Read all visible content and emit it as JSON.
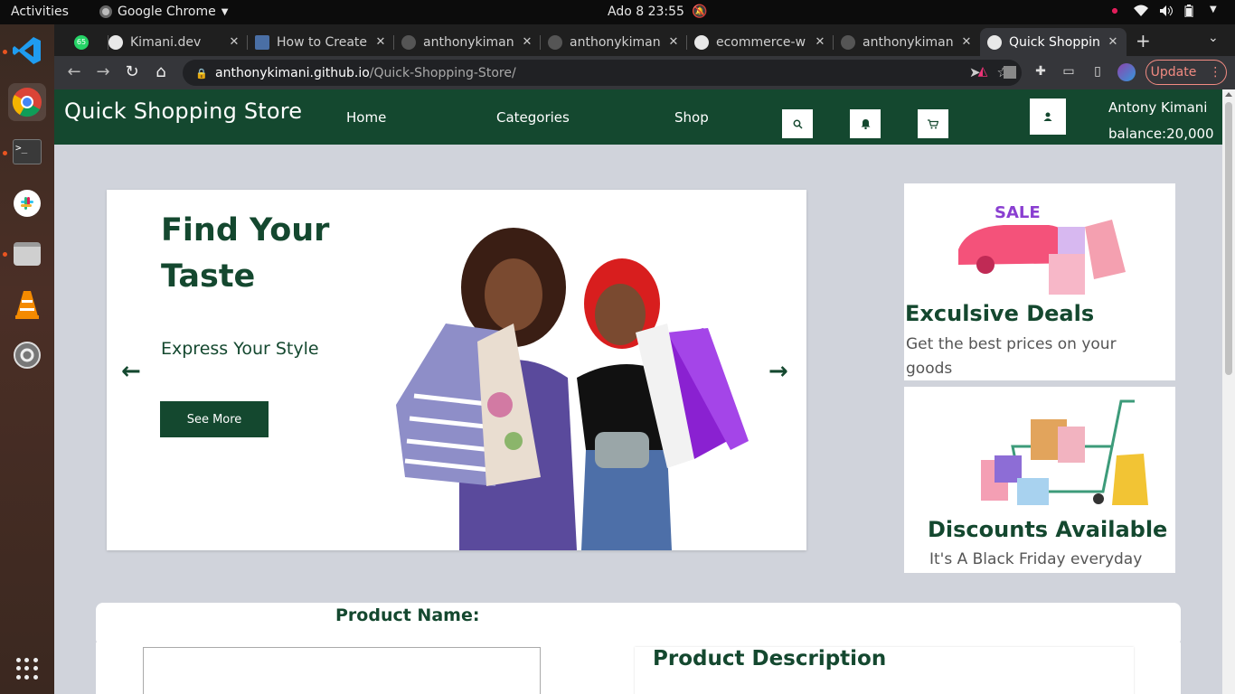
{
  "os": {
    "activities_label": "Activities",
    "app_name": "Google Chrome",
    "clock": "Ado 8  23:55"
  },
  "browser": {
    "tabs": [
      {
        "label": "",
        "badge": "65"
      },
      {
        "label": "Kimani.dev"
      },
      {
        "label": "How to Create"
      },
      {
        "label": "anthonykiman"
      },
      {
        "label": "anthonykiman"
      },
      {
        "label": "ecommerce-w"
      },
      {
        "label": "anthonykiman"
      },
      {
        "label": "Quick Shoppin"
      }
    ],
    "url_host": "anthonykimani.github.io",
    "url_path": "/Quick-Shopping-Store/",
    "update_label": "Update"
  },
  "site": {
    "brand": "Quick Shopping Store",
    "nav": [
      "Home",
      "Categories",
      "Shop"
    ],
    "user_name": "Antony Kimani",
    "user_balance": "balance:20,000",
    "hero": {
      "title_line1": "Find Your",
      "title_line2": "Taste",
      "subtitle": "Express Your Style",
      "cta": "See More",
      "prev_arrow": "←",
      "next_arrow": "→"
    },
    "deal1": {
      "title": "Exculsive Deals",
      "desc": "Get the best prices on your goods",
      "art_label": "SALE"
    },
    "deal2": {
      "title": "Discounts Available",
      "desc": "It's A Black Friday everyday"
    },
    "product_name_label": "Product Name:",
    "product_description_label": "Product Description"
  },
  "colors": {
    "brand_green": "#14482f",
    "page_bg": "#d0d3db",
    "update_red": "#f28b82"
  }
}
